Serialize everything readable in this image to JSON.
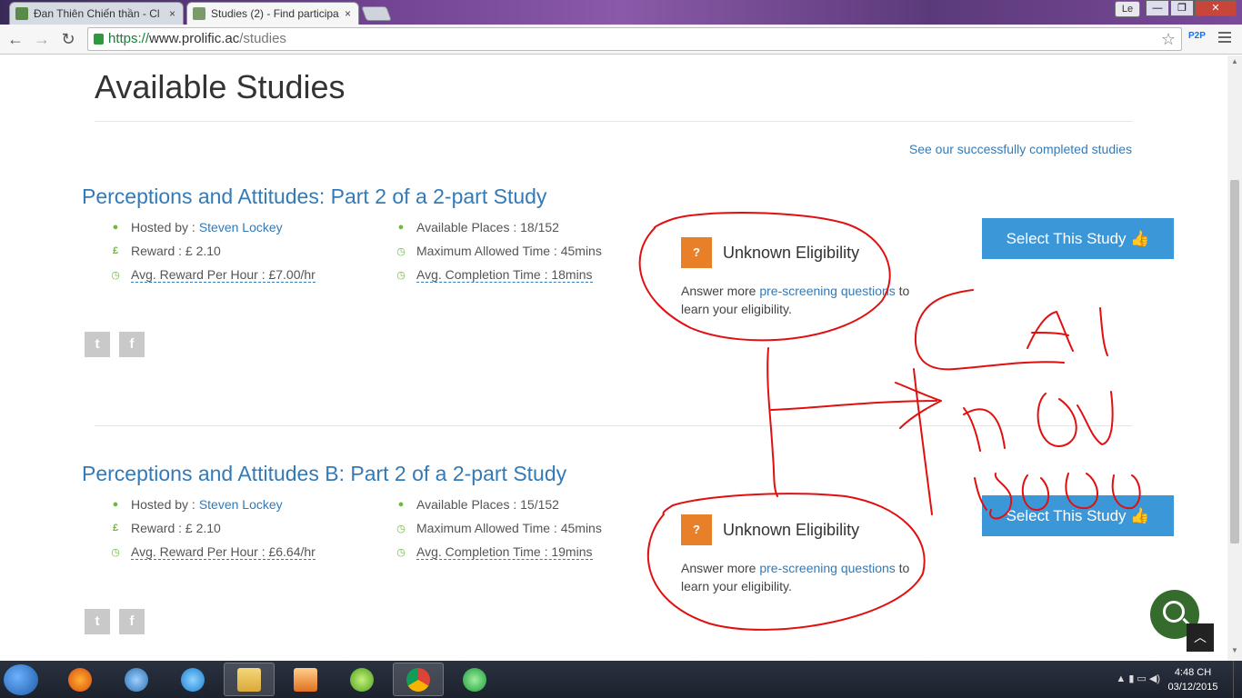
{
  "browser": {
    "tabs": [
      {
        "title": "Đan Thiên Chiến thần - Cl",
        "active": false
      },
      {
        "title": "Studies (2) - Find participa",
        "active": true
      }
    ],
    "tab_close": "×",
    "profile": "Le",
    "window_buttons": {
      "minimize": "—",
      "maximize": "❐",
      "close": "✕"
    },
    "nav": {
      "back": "←",
      "forward": "→",
      "reload": "↻"
    },
    "url": {
      "scheme": "https://",
      "host": "www.prolific.ac",
      "path": "/studies"
    },
    "bookmark_star": "☆",
    "extension": "P2P"
  },
  "page": {
    "title": "Available Studies",
    "completed_link": "See our successfully completed studies",
    "studies": [
      {
        "title": "Perceptions and Attitudes: Part 2 of a 2-part Study",
        "hosted_label": "Hosted by :",
        "host": "Steven Lockey",
        "reward": "Reward : £ 2.10",
        "avg_reward_per_hour": "Avg. Reward Per Hour : £7.00/hr",
        "available_places": "Available Places : 18/152",
        "max_time": "Maximum Allowed Time : 45mins",
        "avg_completion": "Avg. Completion Time : 18mins",
        "eligibility_badge": "?",
        "eligibility_title": "Unknown Eligibility",
        "eligibility_pre": "Answer more",
        "eligibility_link": "pre-screening questions",
        "eligibility_post": "to learn your eligibility.",
        "select_button": "Select This Study 👍"
      },
      {
        "title": "Perceptions and Attitudes B: Part 2 of a 2-part Study",
        "hosted_label": "Hosted by :",
        "host": "Steven Lockey",
        "reward": "Reward : £ 2.10",
        "avg_reward_per_hour": "Avg. Reward Per Hour : £6.64/hr",
        "available_places": "Available Places : 15/152",
        "max_time": "Maximum Allowed Time : 45mins",
        "avg_completion": "Avg. Completion Time : 19mins",
        "eligibility_badge": "?",
        "eligibility_title": "Unknown Eligibility",
        "eligibility_pre": "Answer more",
        "eligibility_link": "pre-screening questions",
        "eligibility_post": "to learn your eligibility.",
        "select_button": "Select This Study 👍"
      }
    ],
    "icons": {
      "user": "●",
      "pound": "£",
      "clock": "◷",
      "twitter": "t",
      "facebook": "f",
      "chevron_up": "︿"
    }
  },
  "taskbar": {
    "time": "4:48 CH",
    "date": "03/12/2015",
    "tray_text": "▲  ▮  ▭  ◀)"
  },
  "colors": {
    "link": "#337ab7",
    "button": "#3b97d8",
    "eligibility_orange": "#e8802a",
    "icon_green": "#6cbb3c",
    "annotation_red": "#e01010"
  }
}
